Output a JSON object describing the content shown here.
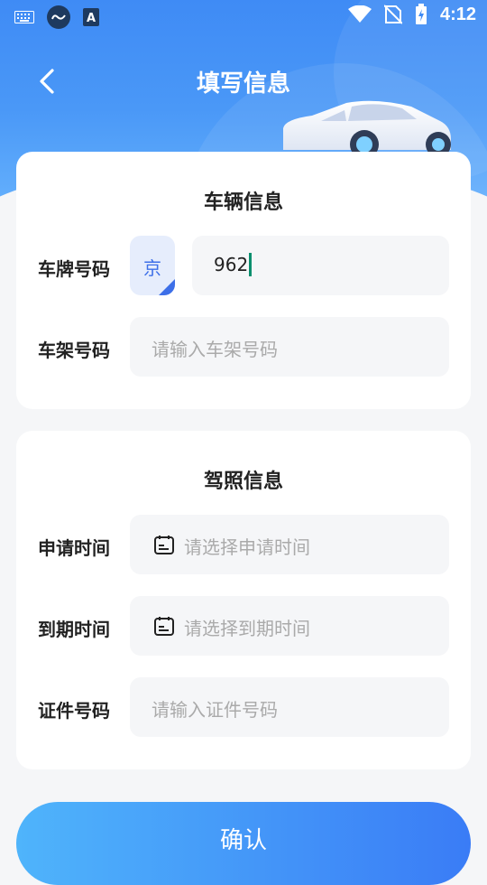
{
  "status_bar": {
    "time": "4:12",
    "left_icons": [
      "keyboard-icon",
      "app-loop-icon",
      "accessibility-a-icon"
    ],
    "right_icons": [
      "wifi-icon",
      "no-sim-icon",
      "battery-charging-icon"
    ]
  },
  "header": {
    "title": "填写信息",
    "back_icon": "chevron-left-icon"
  },
  "vehicle_card": {
    "title": "车辆信息",
    "plate_label": "车牌号码",
    "province": "京",
    "plate_value": "962",
    "frame_label": "车架号码",
    "frame_placeholder": "请输入车架号码"
  },
  "license_card": {
    "title": "驾照信息",
    "apply_label": "申请时间",
    "apply_placeholder": "请选择申请时间",
    "expire_label": "到期时间",
    "expire_placeholder": "请选择到期时间",
    "cert_label": "证件号码",
    "cert_placeholder": "请输入证件号码"
  },
  "confirm_button": "确认",
  "colors": {
    "brand_blue": "#3f8bf5",
    "accent": "#3d6fe8",
    "caret": "#0a8f6e"
  }
}
